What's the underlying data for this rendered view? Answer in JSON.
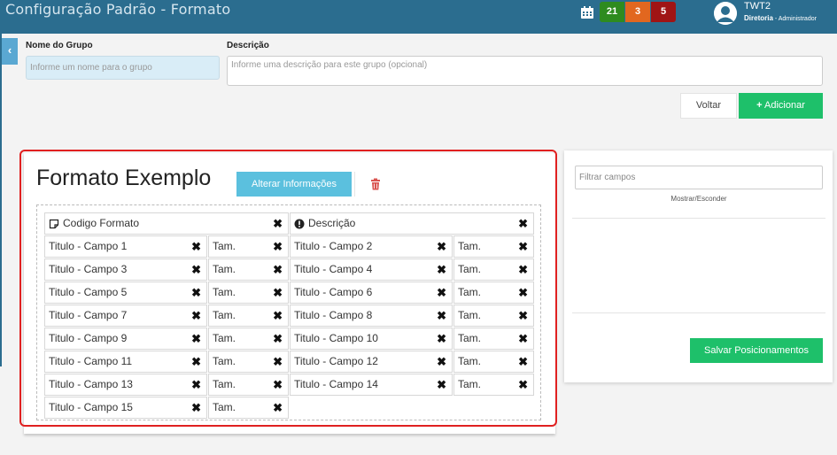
{
  "header": {
    "title": "Configuração Padrão - Formato",
    "badges": [
      "21",
      "3",
      "5"
    ],
    "user": {
      "name": "TWT2",
      "role_main": "Diretoria",
      "role_sep": " - ",
      "role_sub": "Administrador"
    }
  },
  "form": {
    "group_name_label": "Nome do Grupo",
    "group_name_placeholder": "Informe um nome para o grupo",
    "description_label": "Descrição",
    "description_placeholder": "Informe uma descrição para este grupo (opcional)",
    "back_label": "Voltar",
    "add_label": "Adicionar"
  },
  "format": {
    "title": "Formato Exemplo",
    "edit_label": "Alterar Informações",
    "header_fields": [
      "Codigo Formato",
      "Descrição"
    ],
    "fields": [
      "Titulo - Campo 1",
      "Titulo - Campo 2",
      "Titulo - Campo 3",
      "Titulo - Campo 4",
      "Titulo - Campo 5",
      "Titulo - Campo 6",
      "Titulo - Campo 7",
      "Titulo - Campo 8",
      "Titulo - Campo 9",
      "Titulo - Campo 10",
      "Titulo - Campo 11",
      "Titulo - Campo 12",
      "Titulo - Campo 13",
      "Titulo - Campo 14",
      "Titulo - Campo 15"
    ],
    "size_label": "Tam.",
    "remove_glyph": "✖"
  },
  "side": {
    "filter_placeholder": "Filtrar campos",
    "toggle_label": "Mostrar/Esconder",
    "save_label": "Salvar Posicionamentos"
  },
  "colors": {
    "header_bg": "#2b6d8f",
    "badge_green": "#2e8b1f",
    "badge_orange": "#e2671f",
    "badge_red": "#a01414",
    "primary_green": "#1ec06a",
    "info_blue": "#5bc0de",
    "highlight_red": "#e02020"
  }
}
